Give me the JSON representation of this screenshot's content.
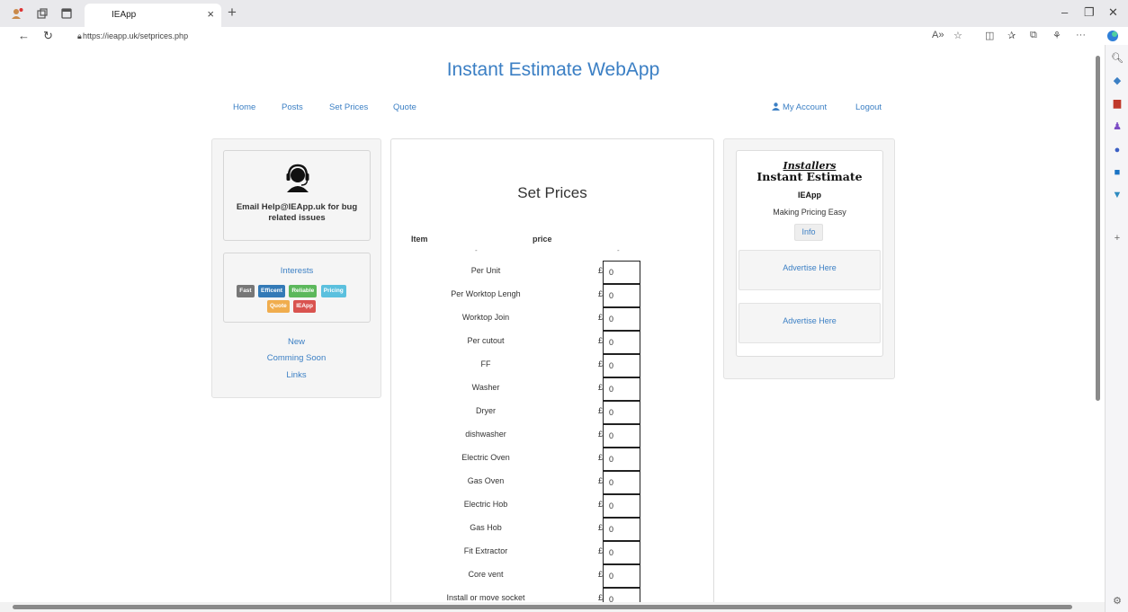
{
  "browser": {
    "tab_title": "IEApp",
    "url": "https://ieapp.uk/setprices.php"
  },
  "site": {
    "title": "Instant Estimate WebApp",
    "nav": [
      {
        "label": "Home"
      },
      {
        "label": "Posts"
      },
      {
        "label": "Set Prices"
      },
      {
        "label": "Quote"
      }
    ],
    "account_label": "My Account",
    "logout_label": "Logout"
  },
  "left": {
    "help_line1": "Email Help@IEApp.uk for bug",
    "help_line2": "related issues",
    "interests_title": "Interests",
    "badges": [
      {
        "label": "Fast",
        "color": "#777777"
      },
      {
        "label": "Efficent",
        "color": "#337ab7"
      },
      {
        "label": "Reliable",
        "color": "#5cb85c"
      },
      {
        "label": "Pricing",
        "color": "#5bc0de"
      },
      {
        "label": "Quote",
        "color": "#f0ad4e"
      },
      {
        "label": "IEApp",
        "color": "#d9534f"
      }
    ],
    "links": [
      "New",
      "Comming Soon",
      "Links"
    ]
  },
  "main": {
    "title": "Set Prices",
    "col_item": "Item",
    "col_price": "price",
    "dash": "-",
    "currency": "£",
    "rows": [
      {
        "item": "Per Unit",
        "price": "0"
      },
      {
        "item": "Per Worktop Lengh",
        "price": "0"
      },
      {
        "item": "Worktop Join",
        "price": "0"
      },
      {
        "item": "Per cutout",
        "price": "0"
      },
      {
        "item": "FF",
        "price": "0"
      },
      {
        "item": "Washer",
        "price": "0"
      },
      {
        "item": "Dryer",
        "price": "0"
      },
      {
        "item": "dishwasher",
        "price": "0"
      },
      {
        "item": "Electric Oven",
        "price": "0"
      },
      {
        "item": "Gas Oven",
        "price": "0"
      },
      {
        "item": "Electric Hob",
        "price": "0"
      },
      {
        "item": "Gas Hob",
        "price": "0"
      },
      {
        "item": "Fit Extractor",
        "price": "0"
      },
      {
        "item": "Core vent",
        "price": "0"
      },
      {
        "item": "Install or move socket",
        "price": "0"
      }
    ]
  },
  "right": {
    "installers": "Installers",
    "title": "Instant Estimate",
    "app": "IEApp",
    "tagline": "Making Pricing Easy",
    "info_label": "Info",
    "ads": [
      "Advertise Here",
      "Advertise Here"
    ]
  },
  "colors": {
    "link": "#3b7fc4",
    "panel_bg": "#f5f5f5"
  }
}
